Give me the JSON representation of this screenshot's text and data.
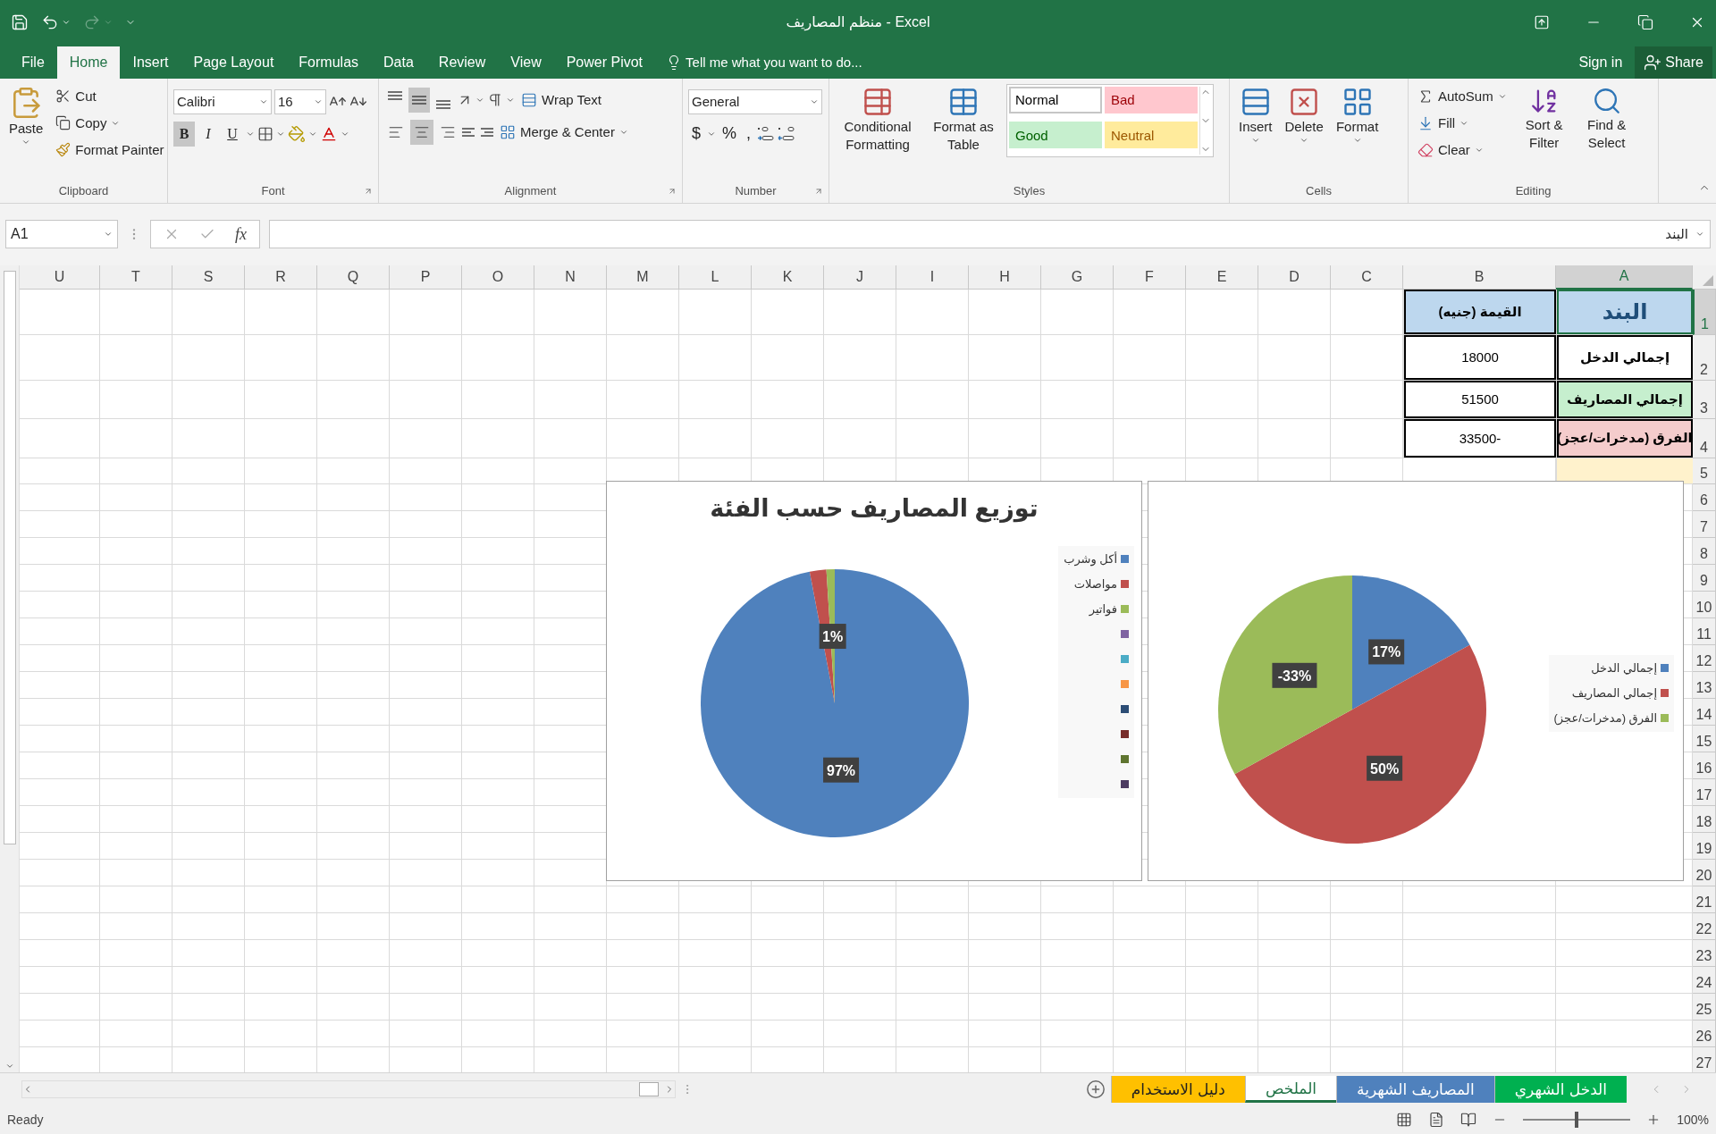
{
  "window": {
    "title": "منظم المصاريف - Excel"
  },
  "menu": {
    "tabs": [
      {
        "label": "File",
        "selected": false
      },
      {
        "label": "Home",
        "selected": true
      },
      {
        "label": "Insert",
        "selected": false
      },
      {
        "label": "Page Layout",
        "selected": false
      },
      {
        "label": "Formulas",
        "selected": false
      },
      {
        "label": "Data",
        "selected": false
      },
      {
        "label": "Review",
        "selected": false
      },
      {
        "label": "View",
        "selected": false
      },
      {
        "label": "Power Pivot",
        "selected": false
      }
    ],
    "tell_me": "Tell me what you want to do...",
    "sign_in": "Sign in",
    "share": "Share"
  },
  "ribbon": {
    "clipboard": {
      "label": "Clipboard",
      "paste": "Paste",
      "cut": "Cut",
      "copy": "Copy",
      "format_painter": "Format Painter"
    },
    "font": {
      "label": "Font",
      "font_name": "Calibri",
      "font_size": "16",
      "styles": [
        {
          "text": "B",
          "selected": true
        },
        {
          "text": "I",
          "selected": false
        },
        {
          "text": "U",
          "selected": false
        }
      ]
    },
    "alignment": {
      "label": "Alignment",
      "vertical": [
        {
          "selected": false
        },
        {
          "selected": true
        },
        {
          "selected": false
        }
      ],
      "horizontal": [
        {
          "selected": false
        },
        {
          "selected": true
        },
        {
          "selected": false
        }
      ],
      "wrap_text": "Wrap Text",
      "merge_center": "Merge & Center"
    },
    "number": {
      "label": "Number",
      "format": "General",
      "currency": "$",
      "percent": "%",
      "comma": ","
    },
    "styles": {
      "label": "Styles",
      "conditional_formatting": "Conditional Formatting",
      "format_as_table": "Format as Table",
      "cell_styles": [
        {
          "label": "Normal",
          "kind": "normal"
        },
        {
          "label": "Bad",
          "kind": "bad"
        },
        {
          "label": "Good",
          "kind": "good"
        },
        {
          "label": "Neutral",
          "kind": "neutral"
        }
      ]
    },
    "cells": {
      "label": "Cells",
      "buttons": [
        "Insert",
        "Delete",
        "Format"
      ]
    },
    "editing": {
      "label": "Editing",
      "autosum": "AutoSum",
      "fill": "Fill",
      "clear": "Clear",
      "sort_filter": "Sort & Filter",
      "find_select": "Find & Select"
    }
  },
  "formula_bar": {
    "name_box": "A1",
    "fx": "fx",
    "value": "البند"
  },
  "sheet": {
    "columns": [
      "U",
      "T",
      "S",
      "R",
      "Q",
      "P",
      "O",
      "N",
      "M",
      "L",
      "K",
      "J",
      "I",
      "H",
      "G",
      "F",
      "E",
      "D",
      "C",
      "B",
      "A"
    ],
    "rows": [
      "1",
      "2",
      "3",
      "4",
      "5",
      "6",
      "7",
      "8",
      "9",
      "10",
      "11",
      "12",
      "13",
      "14",
      "15",
      "16",
      "17",
      "18",
      "19",
      "20",
      "21",
      "22",
      "23",
      "24",
      "25",
      "26",
      "27"
    ],
    "table": [
      {
        "kind": "header",
        "selected": true,
        "item": {
          "text": "البند",
          "color": "#bdd7ee"
        },
        "value": {
          "text": "القيمة (جنيه)",
          "color": "#bdd7ee"
        }
      },
      {
        "kind": "data",
        "selected": false,
        "item": {
          "text": "إجمالي الدخل",
          "color": "#ffffff"
        },
        "value": {
          "text": "18000",
          "color": "#ffffff"
        }
      },
      {
        "kind": "data",
        "selected": false,
        "item": {
          "text": "إجمالي المصاريف",
          "color": "#c6efce"
        },
        "value": {
          "text": "51500",
          "color": "#ffffff"
        }
      },
      {
        "kind": "data",
        "selected": false,
        "item": {
          "text": "الفرق (مدخرات/عجز)",
          "color": "#f4cccc"
        },
        "value": {
          "text": "-33500",
          "color": "#ffffff"
        }
      },
      {
        "kind": "blank",
        "selected": false,
        "item": {
          "color": "#fff2cc"
        }
      }
    ]
  },
  "charts": [
    {
      "chart_data": {
        "type": "pie",
        "categories": [
          "إجمالي الدخل",
          "إجمالي المصاريف",
          "الفرق (مدخرات/عجز)"
        ],
        "series": [
          {
            "values": [
              17,
              50,
              33
            ]
          }
        ],
        "value_labels": [
          "17%",
          "50%",
          "-33%"
        ],
        "legend": "right"
      },
      "legend_entries": [
        {
          "color": "#4f81bd"
        },
        {
          "color": "#c0504d"
        },
        {
          "color": "#9bbb59"
        }
      ]
    },
    {
      "chart_data": {
        "type": "pie",
        "title": "توزيع المصاريف حسب الفئة",
        "categories": [
          "أكل وشرب",
          "مواصلات",
          "فواتير"
        ],
        "series": [
          {
            "values": [
              97,
              2,
              1
            ]
          }
        ],
        "value_labels": [
          "97%",
          null,
          "1%"
        ],
        "legend": "right"
      },
      "legend_entries": [
        {
          "color": "#4f81bd"
        },
        {
          "color": "#c0504d"
        },
        {
          "color": "#9bbb59"
        },
        {
          "color": "#8064a2"
        },
        {
          "color": "#4bacc6"
        },
        {
          "color": "#f79646"
        },
        {
          "color": "#2c4d75"
        },
        {
          "color": "#772c2a"
        },
        {
          "color": "#5f7530"
        },
        {
          "color": "#4d3b62"
        }
      ]
    }
  ],
  "sheet_tabs": [
    {
      "label": "الدخل الشهري",
      "color": "#00b050",
      "selected": false
    },
    {
      "label": "المصاريف الشهرية",
      "color": "#4f81bd",
      "selected": false
    },
    {
      "label": "الملخص",
      "color": "#ffffff",
      "selected": true
    },
    {
      "label": "دليل الاستخدام",
      "color": "#ffc000",
      "selected": false
    }
  ],
  "status_bar": {
    "status": "Ready",
    "zoom": "100%",
    "zoom_slider": {
      "level": 0.5
    }
  }
}
